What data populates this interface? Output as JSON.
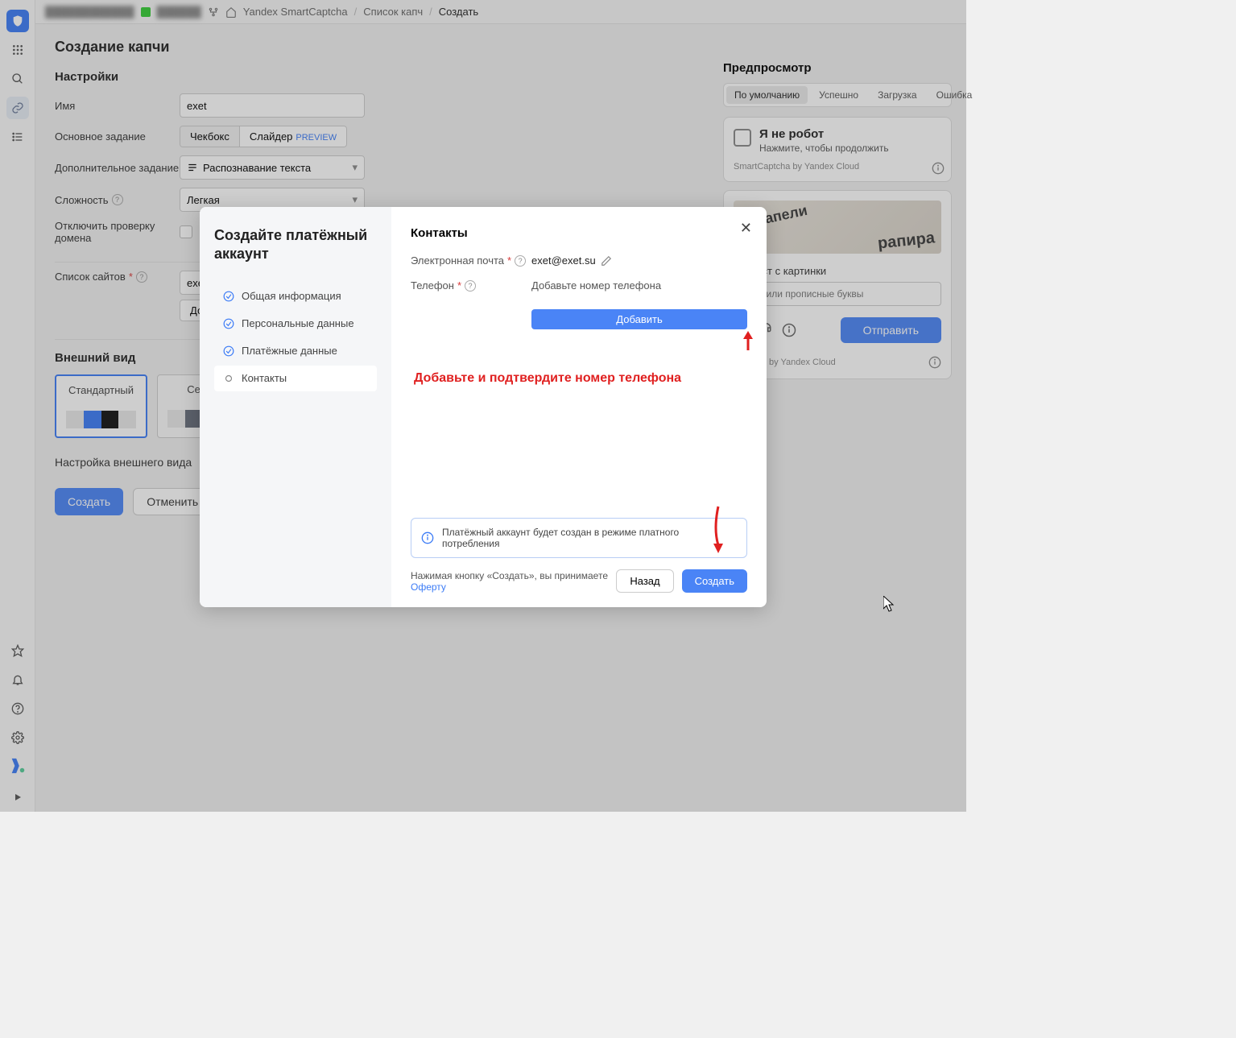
{
  "breadcrumb": {
    "app": "Yandex SmartCaptcha",
    "list": "Список капч",
    "create": "Создать"
  },
  "page": {
    "title": "Создание капчи",
    "settings_heading": "Настройки",
    "appearance_heading": "Внешний вид",
    "appearance_config": "Настройка внешнего вида",
    "btn_create": "Создать",
    "btn_cancel": "Отменить"
  },
  "form": {
    "name_label": "Имя",
    "name_value": "exet",
    "main_task_label": "Основное задание",
    "task_checkbox": "Чекбокс",
    "task_slider": "Слайдер",
    "task_preview": "PREVIEW",
    "extra_task_label": "Дополнительное задание",
    "extra_task_value": "Распознавание текста",
    "difficulty_label": "Сложность",
    "difficulty_value": "Легкая",
    "disable_domain_label": "Отключить проверку домена",
    "sites_label": "Список сайтов",
    "sites_value": "exet.su",
    "btn_add": "Добавить"
  },
  "cards": {
    "standard": "Стандартный",
    "gray": "Серый"
  },
  "preview": {
    "heading": "Предпросмотр",
    "tab_default": "По умолчанию",
    "tab_success": "Успешно",
    "tab_loading": "Загрузка",
    "tab_error": "Ошибка",
    "not_robot": "Я не робот",
    "click_continue": "Нажмите, чтобы продолжить",
    "brand": "SmartCaptcha by Yandex Cloud",
    "challenge_label": "те текст с картинки",
    "placeholder": "чные или прописные буквы",
    "btn_submit": "Отправить",
    "brand2": "Captcha by Yandex Cloud",
    "captcha_word1": "запели",
    "captcha_word2": "рапира"
  },
  "modal": {
    "title": "Создайте платёжный аккаунт",
    "steps": {
      "general": "Общая информация",
      "personal": "Персональные данные",
      "payment": "Платёжные данные",
      "contacts": "Контакты"
    },
    "section": "Контакты",
    "email_label": "Электронная почта",
    "email_value": "exet@exet.su",
    "phone_label": "Телефон",
    "phone_hint": "Добавьте номер телефона",
    "btn_add_phone": "Добавить",
    "annotation": "Добавьте и подтвердите номер телефона",
    "info_banner": "Платёжный аккаунт будет создан в режиме платного потребления",
    "terms_prefix": "Нажимая кнопку «Создать», вы принимаете ",
    "terms_link": "Оферту",
    "btn_back": "Назад",
    "btn_create": "Создать"
  }
}
